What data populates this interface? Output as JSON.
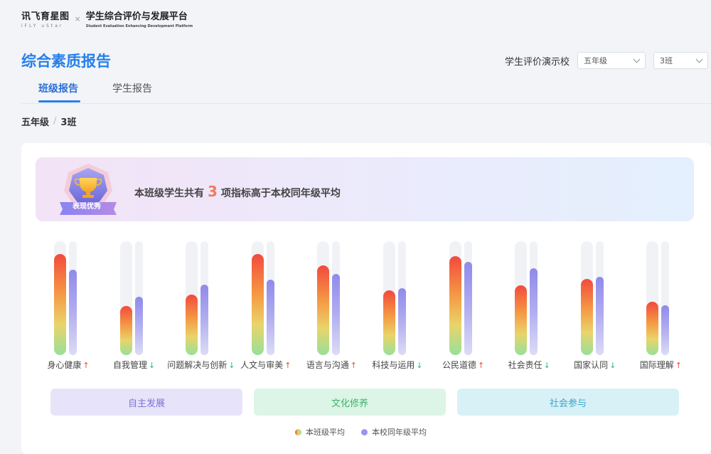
{
  "brand": {
    "logo_main": "讯飞育星图",
    "logo_sub": "iFLY uStar",
    "separator": "×",
    "platform_main": "学生综合评价与发展平台",
    "platform_sub": "Student Evaluation Enhancing Development Platform"
  },
  "page_title": "综合素质报告",
  "filters": {
    "school": "学生评价演示校",
    "grade": "五年级",
    "class": "3班"
  },
  "tabs": [
    {
      "label": "班级报告",
      "active": true
    },
    {
      "label": "学生报告",
      "active": false
    }
  ],
  "breadcrumb": {
    "grade": "五年级",
    "sep": "/",
    "class": "3班"
  },
  "banner": {
    "badge_label": "表现优秀",
    "text_before": "本班级学生共有",
    "count": "3",
    "text_after": "项指标高于本校同年级平均"
  },
  "chart_data": {
    "type": "bar",
    "categories": [
      "身心健康",
      "自我管理",
      "问题解决与创新",
      "人文与审美",
      "语言与沟通",
      "科技与运用",
      "公民道德",
      "社会责任",
      "国家认同",
      "国际理解"
    ],
    "trend": [
      "↑",
      "↓",
      "↓",
      "↑",
      "↑",
      "↓",
      "↑",
      "↓",
      "↓",
      "↑"
    ],
    "series": [
      {
        "name": "本班级平均",
        "values": [
          0.89,
          0.43,
          0.53,
          0.89,
          0.79,
          0.57,
          0.87,
          0.61,
          0.67,
          0.47
        ]
      },
      {
        "name": "本校同年级平均",
        "values": [
          0.75,
          0.51,
          0.62,
          0.66,
          0.71,
          0.59,
          0.82,
          0.76,
          0.69,
          0.44
        ]
      }
    ],
    "ylim": [
      0,
      1
    ]
  },
  "groups": [
    "自主发展",
    "文化修养",
    "社会参与"
  ],
  "legend": [
    "本班级平均",
    "本校同年级平均"
  ]
}
